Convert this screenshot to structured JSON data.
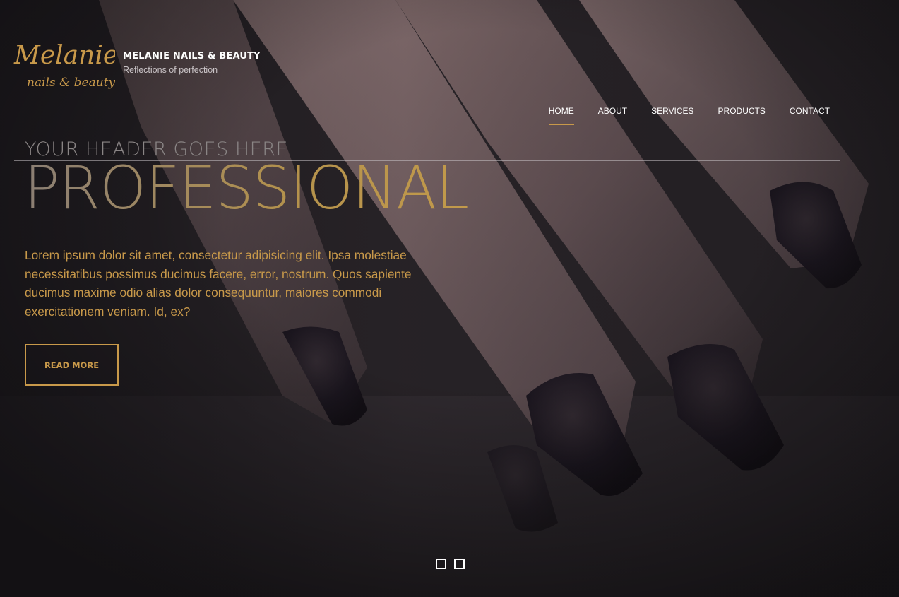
{
  "brand": {
    "logo_script_top": "Melanie",
    "logo_script_bottom": "nails & beauty",
    "name": "MELANIE NAILS & BEAUTY",
    "tagline": "Reflections of perfection"
  },
  "nav": {
    "items": [
      {
        "label": "HOME",
        "active": true
      },
      {
        "label": "ABOUT",
        "active": false
      },
      {
        "label": "SERVICES",
        "active": false
      },
      {
        "label": "PRODUCTS",
        "active": false
      },
      {
        "label": "CONTACT",
        "active": false
      }
    ]
  },
  "hero": {
    "subheader": "YOUR HEADER GOES HERE",
    "title": "PROFESSIONAL",
    "lead": "Lorem ipsum dolor sit amet, consectetur adipisicing elit. Ipsa molestiae necessitatibus possimus ducimus facere, error, nostrum. Quos sapiente ducimus maxime odio alias dolor consequuntur, maiores commodi exercitationem veniam. Id, ex?",
    "cta_label": "READ MORE"
  },
  "slider": {
    "dot_count": 2
  },
  "colors": {
    "accent_gold": "#c8994a",
    "background_dark": "#1c1a1d",
    "text_white": "#ffffff"
  }
}
